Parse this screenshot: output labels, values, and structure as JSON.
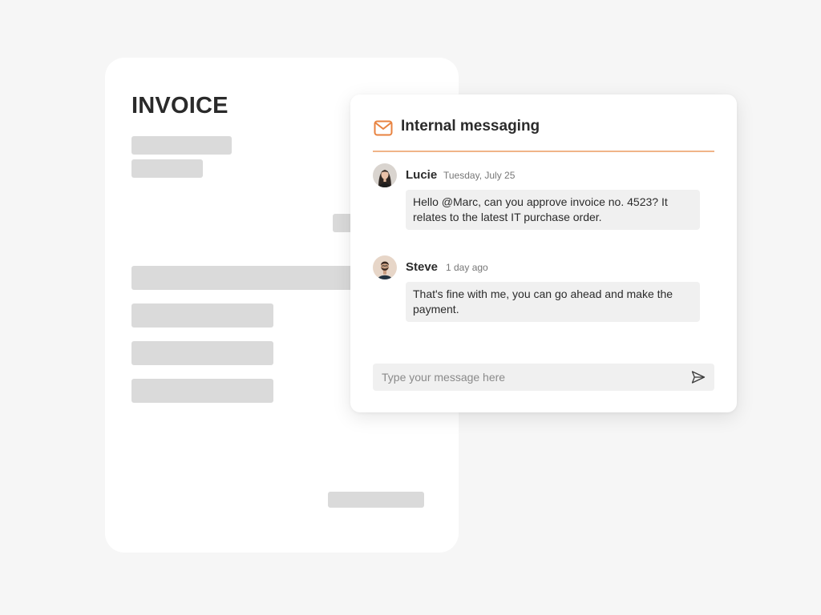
{
  "invoice": {
    "title": "INVOICE"
  },
  "messaging": {
    "title": "Internal messaging",
    "icon": "mail-icon",
    "accent_color": "#e8823f",
    "messages": [
      {
        "author": "Lucie",
        "timestamp": "Tuesday, July 25",
        "text": "Hello @Marc, can you approve invoice no. 4523? It relates to the latest IT purchase order."
      },
      {
        "author": "Steve",
        "timestamp": "1 day ago",
        "text": "That's fine with me, you can go ahead and make the payment."
      }
    ],
    "composer": {
      "placeholder": "Type your message here",
      "send_icon": "send-icon"
    }
  }
}
